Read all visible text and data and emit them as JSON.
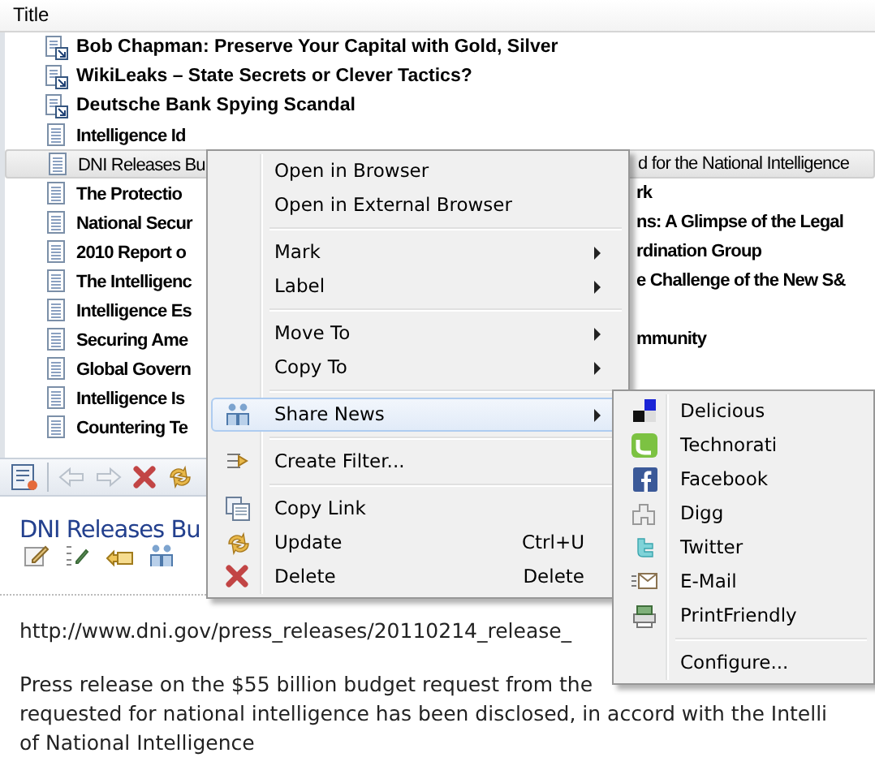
{
  "column_header": "Title",
  "news": [
    {
      "kind": "linked",
      "title": "Bob Chapman: Preserve Your Capital with Gold, Silver",
      "unread": true,
      "selected": false
    },
    {
      "kind": "linked",
      "title": "WikiLeaks – State Secrets or Clever Tactics?",
      "unread": true,
      "selected": false
    },
    {
      "kind": "linked",
      "title": "Deutsche Bank Spying Scandal",
      "unread": true,
      "selected": false
    },
    {
      "kind": "plain",
      "title": "Intelligence Id",
      "unread": true,
      "selected": false
    },
    {
      "kind": "plain",
      "title": "DNI Releases Bu",
      "tail": "d for the National Intelligence",
      "unread": false,
      "selected": true
    },
    {
      "kind": "plain",
      "title": "The Protectio",
      "tail": "rk",
      "unread": true,
      "selected": false
    },
    {
      "kind": "plain",
      "title": "National Secur",
      "tail": "ns: A Glimpse of the Legal",
      "unread": true,
      "selected": false
    },
    {
      "kind": "plain",
      "title": "2010 Report o",
      "tail": "rdination Group",
      "unread": true,
      "selected": false
    },
    {
      "kind": "plain",
      "title": "The Intelligenc",
      "tail": "e Challenge of the New S&",
      "unread": true,
      "selected": false
    },
    {
      "kind": "plain",
      "title": "Intelligence Es",
      "unread": true,
      "selected": false
    },
    {
      "kind": "plain",
      "title": "Securing Ame",
      "tail": "mmunity",
      "unread": true,
      "selected": false
    },
    {
      "kind": "plain",
      "title": "Global Govern",
      "unread": true,
      "selected": false
    },
    {
      "kind": "plain",
      "title": "Intelligence Is",
      "unread": true,
      "selected": false
    },
    {
      "kind": "plain",
      "title": "Countering Te",
      "unread": true,
      "selected": false
    }
  ],
  "article": {
    "headline": "DNI Releases Bu",
    "url": "http://www.dni.gov/press_releases/20110214_release_",
    "body_lines": [
      "Press release on the $55 billion budget request from the",
      "requested for national intelligence has been disclosed, in accord with the Intelli",
      "of National Intelligence"
    ]
  },
  "context_menu": [
    {
      "kind": "item",
      "label": "Open in Browser",
      "submenu": false,
      "selected": false
    },
    {
      "kind": "item",
      "label": "Open in External Browser",
      "submenu": false,
      "selected": false
    },
    {
      "kind": "separator"
    },
    {
      "kind": "item",
      "label": "Mark",
      "submenu": true,
      "selected": false
    },
    {
      "kind": "item",
      "label": "Label",
      "submenu": true,
      "selected": false
    },
    {
      "kind": "separator"
    },
    {
      "kind": "item",
      "label": "Move To",
      "submenu": true,
      "selected": false
    },
    {
      "kind": "item",
      "label": "Copy To",
      "submenu": true,
      "selected": false
    },
    {
      "kind": "separator"
    },
    {
      "kind": "item",
      "label": "Share News",
      "submenu": true,
      "selected": true
    },
    {
      "kind": "separator"
    },
    {
      "kind": "item",
      "label": "Create Filter...",
      "submenu": false,
      "selected": false
    },
    {
      "kind": "separator"
    },
    {
      "kind": "item",
      "label": "Copy Link",
      "submenu": false,
      "selected": false
    },
    {
      "kind": "item",
      "label": "Update",
      "shortcut": "Ctrl+U",
      "submenu": false,
      "selected": false
    },
    {
      "kind": "item",
      "label": "Delete",
      "shortcut": "Delete",
      "submenu": false,
      "selected": false
    }
  ],
  "share_menu": [
    {
      "kind": "item",
      "label": "Delicious"
    },
    {
      "kind": "item",
      "label": "Technorati"
    },
    {
      "kind": "item",
      "label": "Facebook"
    },
    {
      "kind": "item",
      "label": "Digg"
    },
    {
      "kind": "item",
      "label": "Twitter"
    },
    {
      "kind": "item",
      "label": "E-Mail"
    },
    {
      "kind": "item",
      "label": "PrintFriendly"
    },
    {
      "kind": "separator"
    },
    {
      "kind": "item",
      "label": "Configure..."
    }
  ]
}
